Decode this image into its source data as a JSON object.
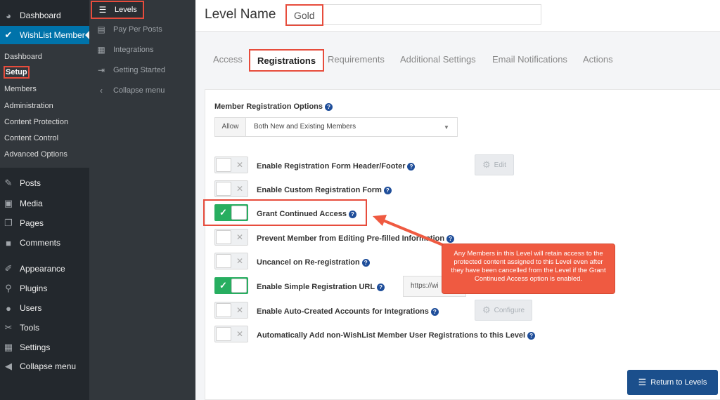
{
  "wp_menu": {
    "dashboard": "Dashboard",
    "wishlist": "WishList Member",
    "posts": "Posts",
    "media": "Media",
    "pages": "Pages",
    "comments": "Comments",
    "appearance": "Appearance",
    "plugins": "Plugins",
    "users": "Users",
    "tools": "Tools",
    "settings": "Settings",
    "collapse": "Collapse menu"
  },
  "wlm_submenu": [
    "Dashboard",
    "Setup",
    "Members",
    "Administration",
    "Content Protection",
    "Content Control",
    "Advanced Options"
  ],
  "wlm_secondary": {
    "levels": "Levels",
    "ppp": "Pay Per Posts",
    "integrations": "Integrations",
    "getting_started": "Getting Started",
    "collapse": "Collapse menu"
  },
  "header": {
    "title": "Level Name",
    "level_value": "Gold"
  },
  "tabs": [
    "Access",
    "Registrations",
    "Requirements",
    "Additional Settings",
    "Email Notifications",
    "Actions"
  ],
  "active_tab": "Registrations",
  "registration": {
    "section_label": "Member Registration Options",
    "allow_label": "Allow",
    "allow_value": "Both New and Existing Members"
  },
  "options": [
    {
      "label": "Enable Registration Form Header/Footer",
      "enabled": false
    },
    {
      "label": "Enable Custom Registration Form",
      "enabled": false
    },
    {
      "label": "Grant Continued Access",
      "enabled": true
    },
    {
      "label": "Prevent Member from Editing Pre-filled Information",
      "enabled": false
    },
    {
      "label": "Uncancel on Re-registration",
      "enabled": false
    },
    {
      "label": "Enable Simple Registration URL",
      "enabled": true
    },
    {
      "label": "Enable Auto-Created Accounts for Integrations",
      "enabled": false
    },
    {
      "label": "Automatically Add non-WishList Member User Registrations to this Level",
      "enabled": false
    }
  ],
  "buttons": {
    "edit": "Edit",
    "configure": "Configure",
    "return": "Return to Levels"
  },
  "url_value": "https://wi",
  "callout_text": "Any Members in this Level will retain access to the protected content assigned to this Level even after they have been cancelled from the Level if the Grant Continued Access option is enabled.",
  "colors": {
    "accent": "#e74c3c",
    "primary": "#1b4f8c",
    "toggle_on": "#27ae60",
    "wp_active": "#0073aa"
  }
}
